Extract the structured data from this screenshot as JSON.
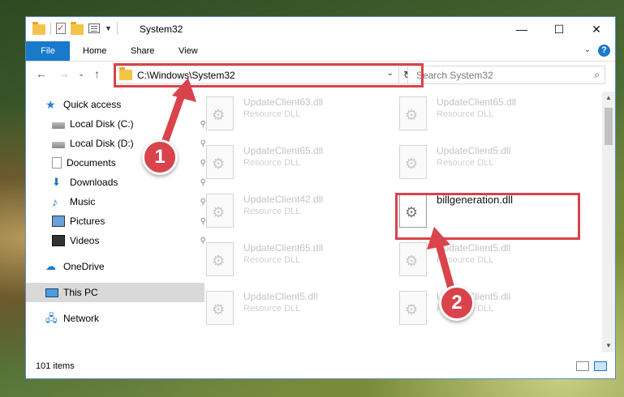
{
  "window": {
    "title": "System32",
    "controls": {
      "minimize": "—",
      "maximize": "☐",
      "close": "✕"
    }
  },
  "ribbon": {
    "tabs": [
      "File",
      "Home",
      "Share",
      "View"
    ],
    "help": "?"
  },
  "address_bar": {
    "path": "C:\\Windows\\System32",
    "refresh_icon": "↻",
    "dropdown_icon": "⌄"
  },
  "search": {
    "placeholder": "Search System32",
    "icon": "⌕"
  },
  "nav_buttons": {
    "back": "←",
    "forward": "→",
    "recent": "⌄",
    "up": "↑"
  },
  "sidebar": {
    "items": [
      {
        "label": "Quick access",
        "icon": "star-icon"
      },
      {
        "label": "Local Disk (C:)",
        "icon": "disk-icon",
        "pinned": true
      },
      {
        "label": "Local Disk (D:)",
        "icon": "disk-icon",
        "pinned": true
      },
      {
        "label": "Documents",
        "icon": "documents-icon",
        "pinned": true
      },
      {
        "label": "Downloads",
        "icon": "download-icon",
        "pinned": true
      },
      {
        "label": "Music",
        "icon": "music-icon",
        "pinned": true
      },
      {
        "label": "Pictures",
        "icon": "pictures-icon",
        "pinned": true
      },
      {
        "label": "Videos",
        "icon": "videos-icon",
        "pinned": true
      },
      {
        "label": "OneDrive",
        "icon": "cloud-icon"
      },
      {
        "label": "This PC",
        "icon": "computer-icon",
        "selected": true
      },
      {
        "label": "Network",
        "icon": "network-icon"
      }
    ],
    "pin_glyph": "📌"
  },
  "files": [
    {
      "name": "UpdateClient63.dll",
      "type": "Resource DLL"
    },
    {
      "name": "UpdateClient65.dll",
      "type": "Resource DLL"
    },
    {
      "name": "UpdateClient65.dll",
      "type": "Resource DLL"
    },
    {
      "name": "UpdateClient5.dll",
      "type": "Resource DLL"
    },
    {
      "name": "UpdateClient42.dll",
      "type": "Resource DLL"
    },
    {
      "name": "billgeneration.dll",
      "type": "",
      "highlighted": true
    },
    {
      "name": "UpdateClient65.dll",
      "type": "Resource DLL"
    },
    {
      "name": "UpdateClient5.dll",
      "type": "Resource DLL"
    },
    {
      "name": "UpdateClient5.dll",
      "type": "Resource DLL"
    },
    {
      "name": "UpdateClient5.dll",
      "type": "Resource DLL"
    }
  ],
  "status": {
    "item_count": "101 items"
  },
  "annotations": {
    "step1": "1",
    "step2": "2",
    "color": "#d9434b"
  }
}
